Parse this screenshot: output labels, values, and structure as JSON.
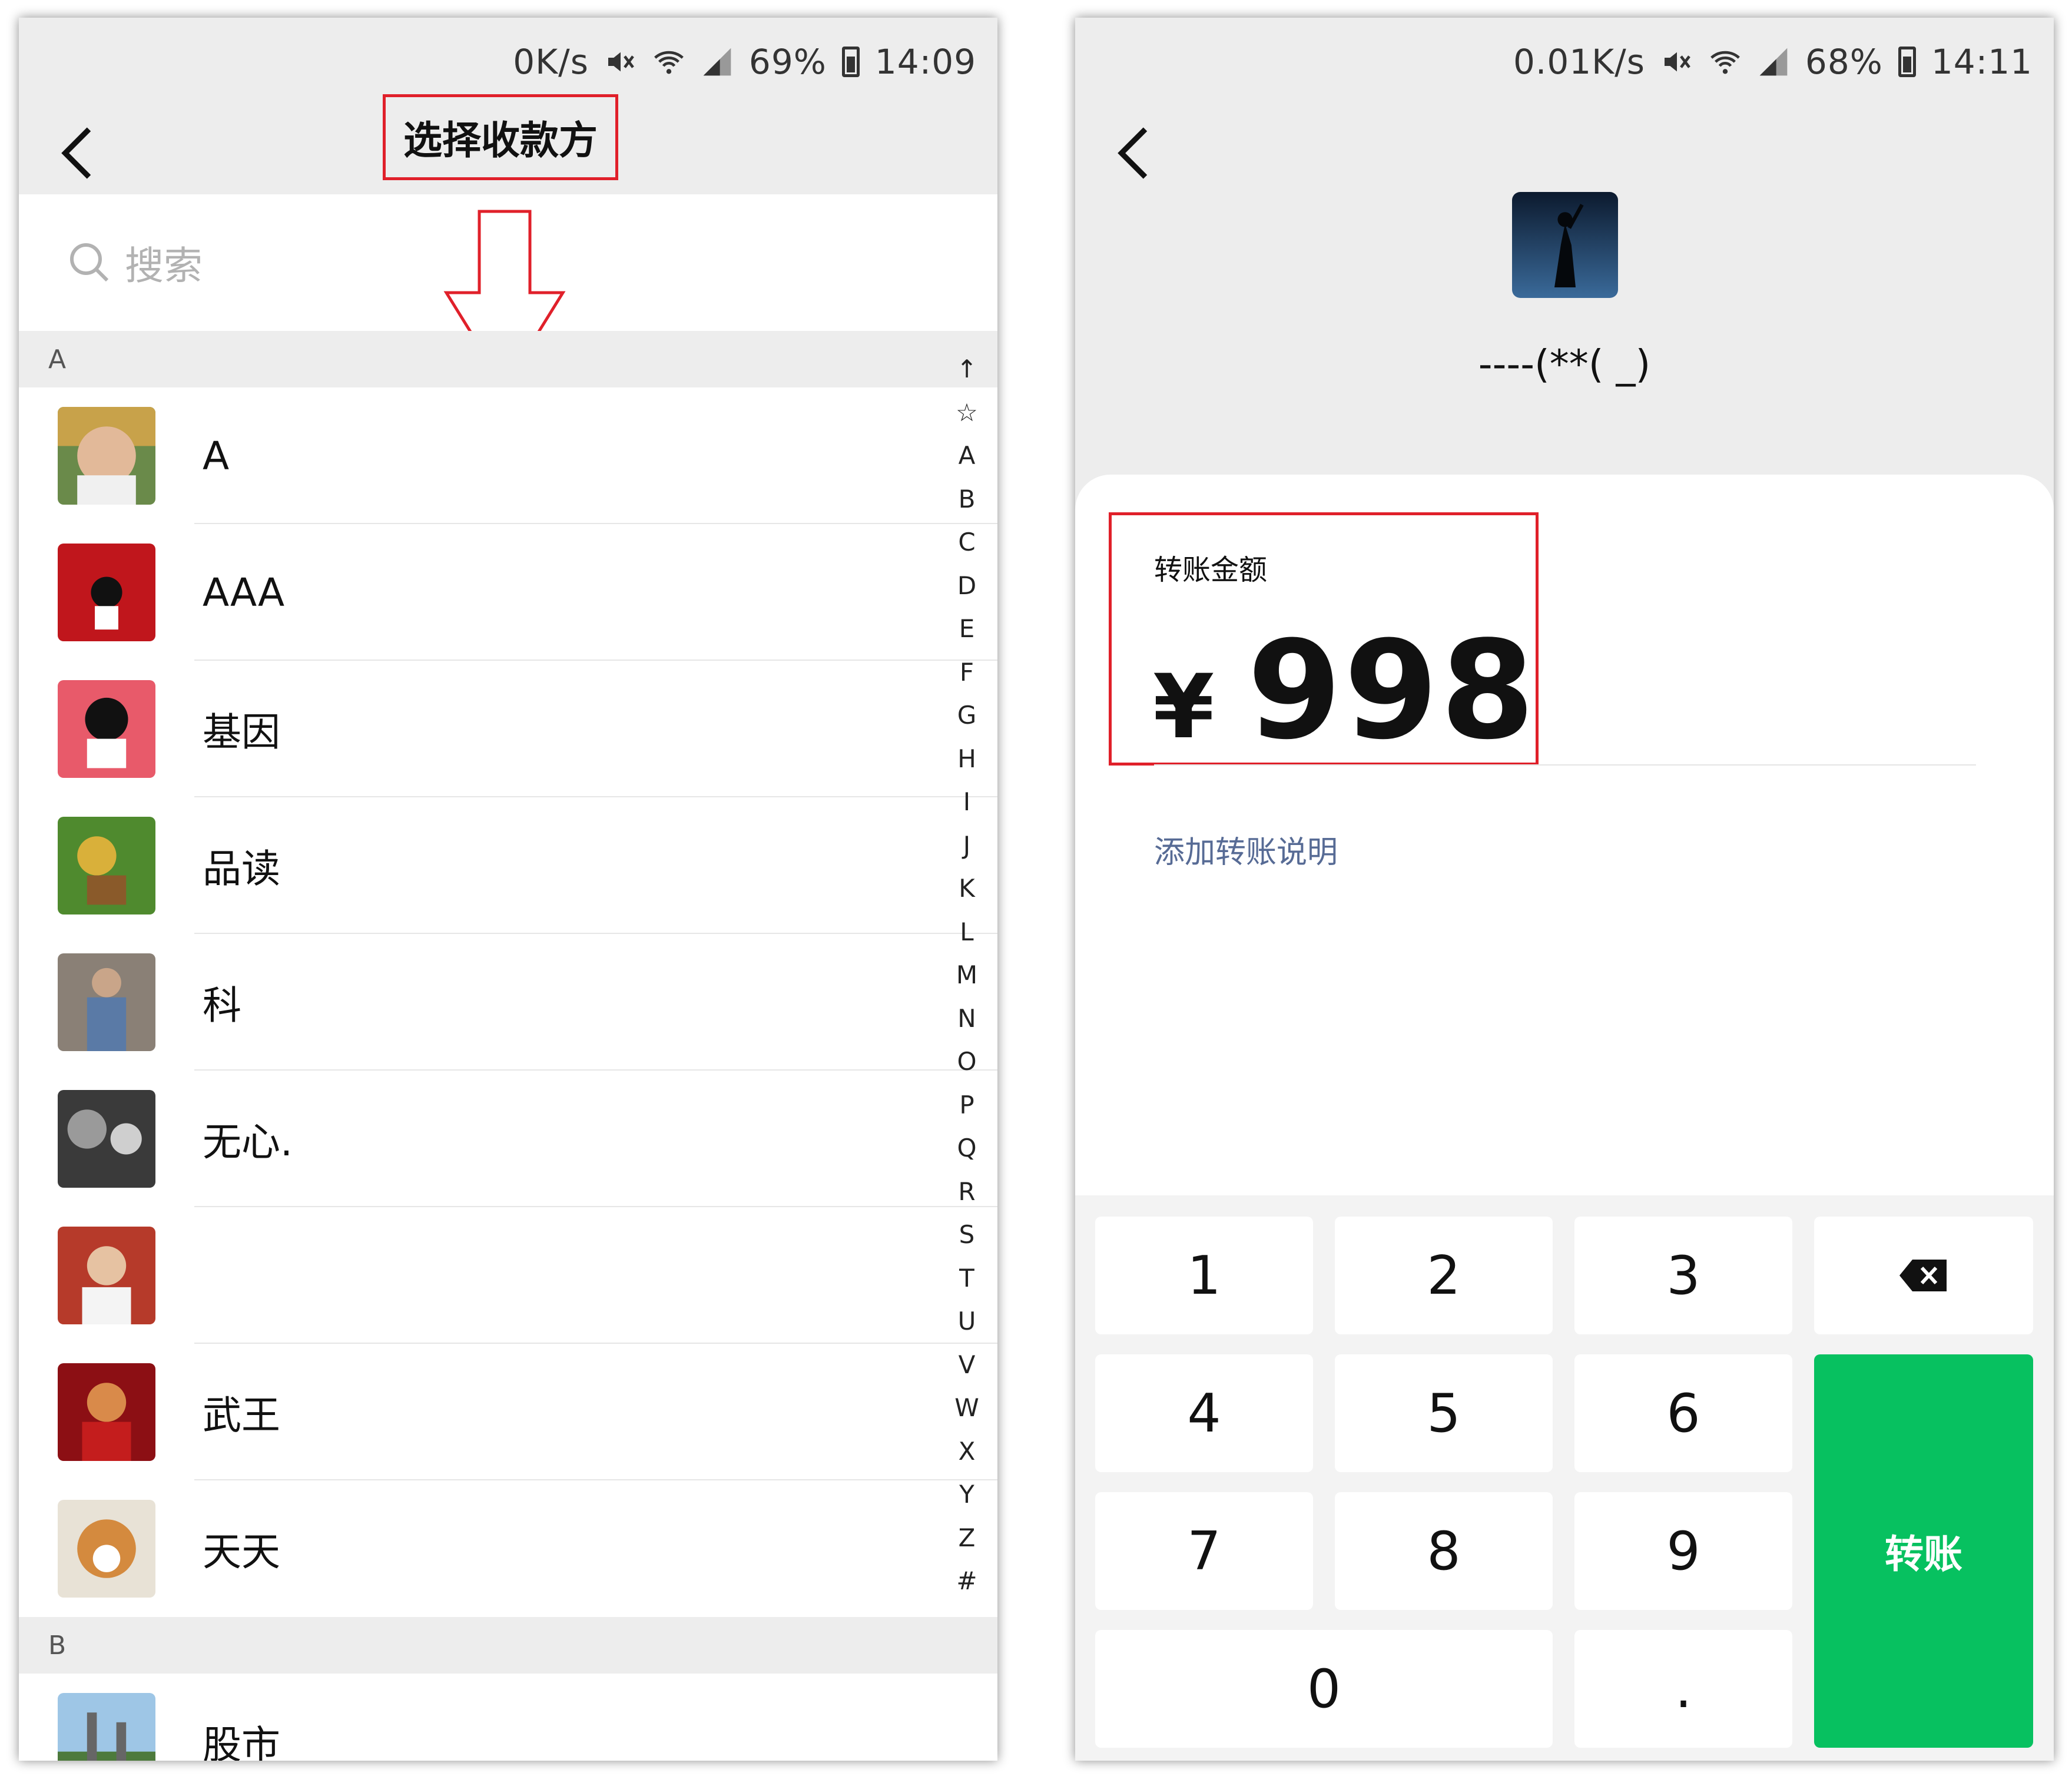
{
  "left": {
    "status": {
      "speed": "0K/s",
      "battery": "69%",
      "time": "14:09"
    },
    "title": "选择收款方",
    "search": {
      "placeholder": "搜索"
    },
    "sections": [
      {
        "header": "A"
      },
      {
        "header": "B"
      }
    ],
    "contacts_a": [
      {
        "name": "A",
        "avatar": "portrait-photo"
      },
      {
        "name": "AAA",
        "avatar": "cartoon-red"
      },
      {
        "name": "基因",
        "avatar": "cartoon-pink"
      },
      {
        "name": "品读",
        "avatar": "garden-photo"
      },
      {
        "name": "科",
        "avatar": "man-photo"
      },
      {
        "name": "无心.",
        "avatar": "bw-photo"
      },
      {
        "name": "",
        "avatar": "chef-photo"
      },
      {
        "name": "武王",
        "avatar": "red-photo"
      },
      {
        "name": "天天",
        "avatar": "dog-photo"
      }
    ],
    "contacts_b": [
      {
        "name": "股市",
        "avatar": "city-photo"
      }
    ],
    "index": [
      "↑",
      "☆",
      "A",
      "B",
      "C",
      "D",
      "E",
      "F",
      "G",
      "H",
      "I",
      "J",
      "K",
      "L",
      "M",
      "N",
      "O",
      "P",
      "Q",
      "R",
      "S",
      "T",
      "U",
      "V",
      "W",
      "X",
      "Y",
      "Z",
      "#"
    ]
  },
  "right": {
    "status": {
      "speed": "0.01K/s",
      "battery": "68%",
      "time": "14:11"
    },
    "payee_name": "----(**( _)",
    "amount_label": "转账金额",
    "currency": "¥",
    "amount": "998",
    "add_note": "添加转账说明",
    "keys": {
      "k1": "1",
      "k2": "2",
      "k3": "3",
      "k4": "4",
      "k5": "5",
      "k6": "6",
      "k7": "7",
      "k8": "8",
      "k9": "9",
      "k0": "0",
      "dot": ".",
      "pay": "转账"
    },
    "colors": {
      "pay_button": "#07c160",
      "link": "#576b95",
      "highlight": "#e0202a"
    }
  }
}
